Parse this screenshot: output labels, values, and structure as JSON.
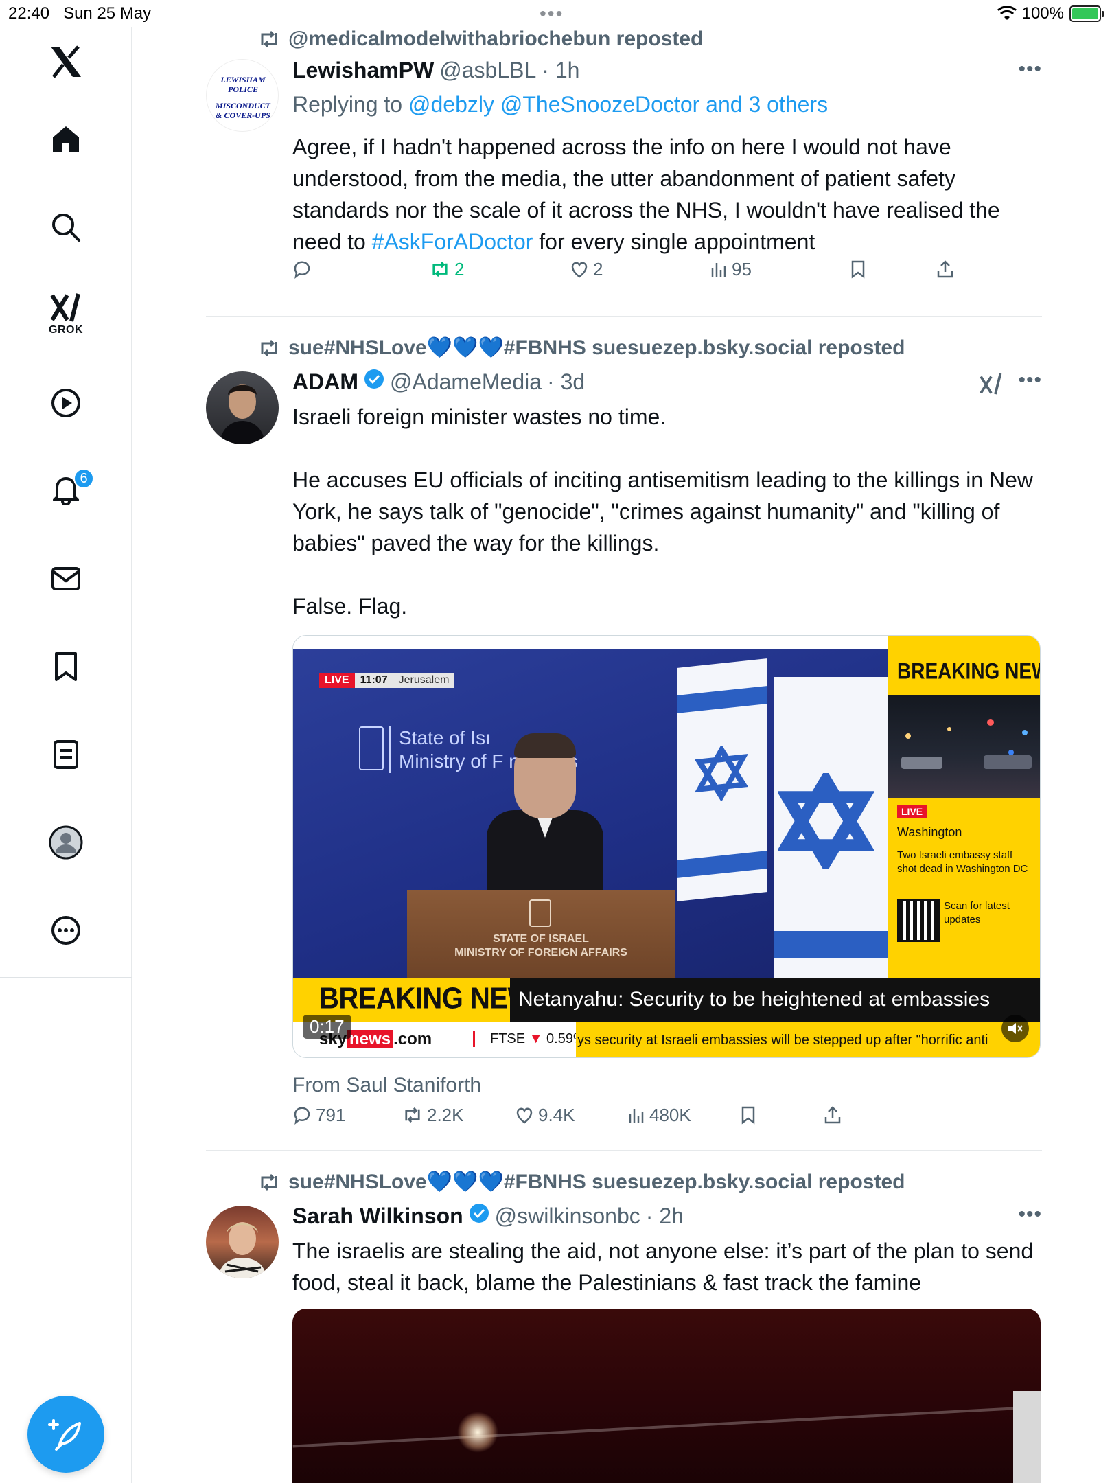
{
  "status_bar": {
    "time": "22:40",
    "date": "Sun 25 May",
    "battery": "100%"
  },
  "sidebar": {
    "items": [
      {
        "name": "x-logo-icon"
      },
      {
        "name": "home-icon"
      },
      {
        "name": "search-icon"
      },
      {
        "name": "grok-icon",
        "label": "GROK"
      },
      {
        "name": "video-icon"
      },
      {
        "name": "notifications-icon",
        "badge": "6"
      },
      {
        "name": "messages-icon"
      },
      {
        "name": "bookmarks-icon"
      },
      {
        "name": "lists-icon"
      },
      {
        "name": "profile-avatar"
      },
      {
        "name": "more-icon"
      }
    ],
    "compose": "compose-icon"
  },
  "tweets": [
    {
      "repost_by": "@medicalmodelwithabriochebun reposted",
      "avatar_lines": [
        "LEWISHAM",
        "POLICE",
        "MISCONDUCT",
        "& COVER-UPS"
      ],
      "name": "LewishamPW",
      "handle": "@asbLBL",
      "time": "· 1h",
      "reply_prefix": "Replying to",
      "reply_to": "@debzly @TheSnoozeDoctor and 3 others",
      "text_before": "Agree, if I hadn't happened across the info on here I would not have understood, from the media, the utter abandonment of patient safety standards nor the scale of it across the NHS, I wouldn't have realised the need to ",
      "hashtag": "#AskForADoctor",
      "text_after": " for every single appointment",
      "stats": {
        "replies": "",
        "reposts": "2",
        "likes": "2",
        "views": "95"
      }
    },
    {
      "repost_by": "sue#NHSLove💙💙💙#FBNHS suesuezep.bsky.social reposted",
      "name": "ADAM",
      "handle": "@AdameMedia",
      "time": "· 3d",
      "text": "Israeli foreign minister wastes no time.\n\nHe accuses EU officials of inciting antisemitism leading to the killings in New York, he says talk of \"genocide\", \"crimes against humanity\" and \"killing of babies\" paved the way for the killings.\n\nFalse. Flag.",
      "video": {
        "live": "LIVE",
        "live_time": "11:07",
        "live_place": "Jerusalem",
        "sign_line1": "State of Isı",
        "sign_line2": "Ministry of F     n Affairs",
        "podium_line1": "STATE OF ISRAEL",
        "podium_line2": "MINISTRY OF FOREIGN AFFAIRS",
        "side_title": "BREAKING NEWS",
        "side_live": "LIVE",
        "side_place": "Washington",
        "side_desc": "Two Israeli embassy staff shot dead in Washington DC",
        "side_qr": "Scan for latest updates",
        "banner_title": "BREAKING NEWS",
        "banner_headline": "Netanyahu: Security to be heightened at embassies",
        "ticker_sky": "sky",
        "ticker_news": "news",
        "ticker_com": ".com",
        "ticker_ftse": "FTSE",
        "ticker_ftse_value": "0.59%",
        "ticker_scroll": "ys security at Israeli embassies will be stepped up after \"horrific anti",
        "duration": "0:17"
      },
      "from": "From Saul Staniforth",
      "stats": {
        "replies": "791",
        "reposts": "2.2K",
        "likes": "9.4K",
        "views": "480K"
      }
    },
    {
      "repost_by": "sue#NHSLove💙💙💙#FBNHS suesuezep.bsky.social reposted",
      "name": "Sarah Wilkinson",
      "handle": "@swilkinsonbc",
      "time": "· 2h",
      "text": "The israelis are stealing the aid, not anyone else: it’s part of the plan to send food, steal it back, blame the Palestinians & fast track the famine"
    }
  ],
  "colors": {
    "accent": "#1d9bf0",
    "retweet_active": "#00ba7c",
    "muted_text": "#536471",
    "breaking_yellow": "#ffd200",
    "sky_red": "#e8142a"
  }
}
